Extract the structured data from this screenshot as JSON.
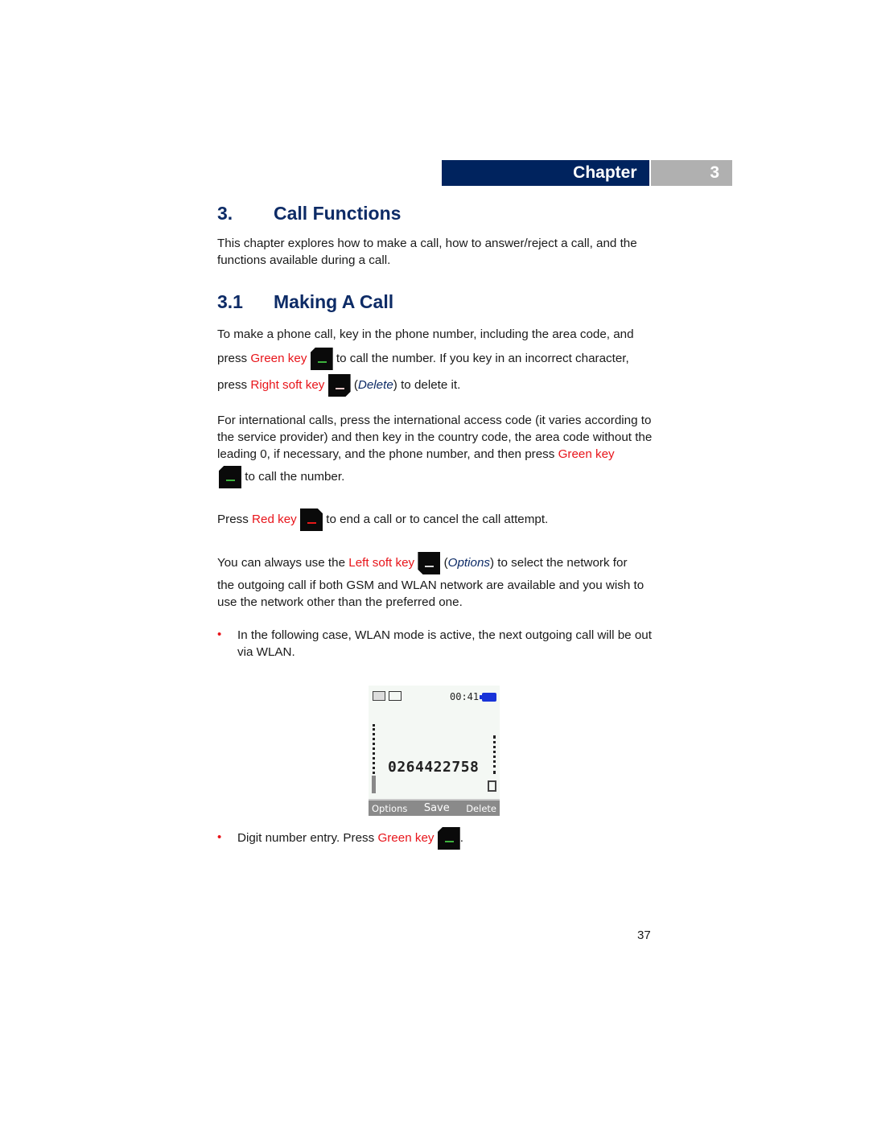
{
  "chapter": {
    "label": "Chapter",
    "number": "3"
  },
  "heading1": {
    "number": "3.",
    "title": "Call Functions"
  },
  "intro": "This chapter explores how to make a call, how to answer/reject a call, and the functions available during a call.",
  "heading2": {
    "number": "3.1",
    "title": "Making A Call"
  },
  "p1": {
    "line1": "To make a phone call, key in the phone number, including the area code, and",
    "press": "press ",
    "green_key": "Green key",
    "after_green": " to call the number. If you key in an incorrect character,",
    "press2": "press ",
    "right_soft_key": "Right soft key",
    "delete_open": " (",
    "delete": "Delete",
    "delete_close": ") to delete it."
  },
  "p2": {
    "text": "For international calls, press the international access code (it varies according to the service provider) and then key in the country code, the area code without the leading 0, if necessary, and the phone number, and then press ",
    "green_key": "Green key",
    "after": " to call the number."
  },
  "p3": {
    "press": "Press ",
    "red_key": "Red key",
    "after": " to end a call or to cancel the call attempt."
  },
  "p4": {
    "before": "You can always use the ",
    "left_soft_key": "Left soft key",
    "options_open": " (",
    "options": "Options",
    "options_close": ") to select the network for",
    "rest": "the outgoing call if both GSM and WLAN network are available and you wish to use the network other than the preferred one."
  },
  "bullets": [
    {
      "marker": "•",
      "text": "In the following case, WLAN mode is active, the next outgoing call will be out via WLAN."
    },
    {
      "marker": "•",
      "text": "Digit number entry. Press ",
      "green_key": "Green key",
      "after": "."
    }
  ],
  "phone_screen": {
    "time": "00:41",
    "number": "0264422758",
    "softkeys": {
      "left": "Options",
      "center": "Save",
      "right": "Delete"
    },
    "icons": [
      "wlan-mode-icon",
      "message-icon",
      "battery-icon"
    ]
  },
  "page_number": "37",
  "colors": {
    "heading": "#0d2b66",
    "chapter_bar": "#00235e",
    "chapter_num_bg": "#b0b0b0",
    "key_highlight": "#e8141a"
  }
}
